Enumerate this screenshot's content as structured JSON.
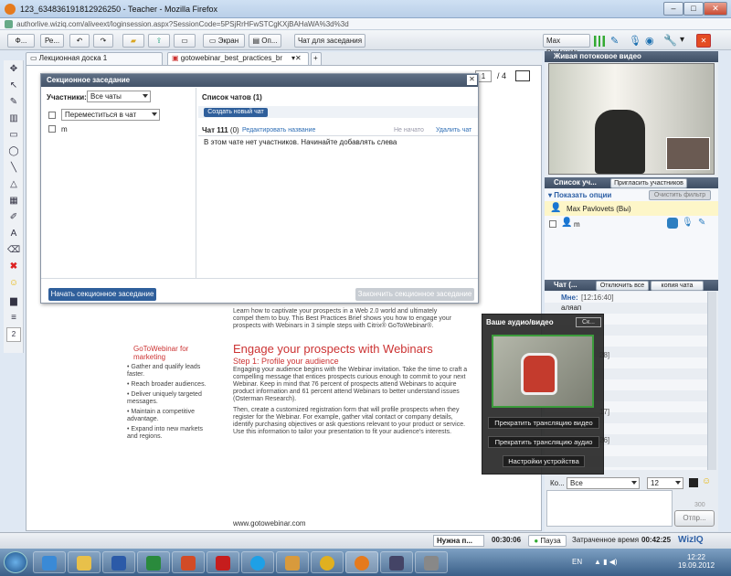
{
  "window": {
    "title": "123_634836191812926250 - Teacher - Mozilla Firefox",
    "url": "authorlive.wiziq.com/aliveext/loginsession.aspx?SessionCode=5PSjRrHFwSTCgKXjBAHaWA%3d%3d"
  },
  "toolbar": {
    "file": "Ф...",
    "re": "Ре...",
    "screen": "Экран",
    "op": "Оп...",
    "chat_meeting": "Чат для заседания",
    "user": "Max Pavlovets"
  },
  "tabs": {
    "board": "Лекционная доска 1",
    "doc": "gotowebinar_best_practices_br",
    "add": "+"
  },
  "pager": {
    "current": "1",
    "total": "/ 4"
  },
  "breakout": {
    "title": "Секционное заседание",
    "participants_label": "Участники:",
    "participants_filter": "Все чаты",
    "move_to_chat": "Переместиться в чат",
    "participant": "m",
    "chat_list_title": "Список чатов (1)",
    "create_chat": "Создать новый чат",
    "chat_name": "Чат 111",
    "chat_count": "(0)",
    "edit_name": "Редактировать название",
    "not_started": "Не начато",
    "delete_chat": "Удалить чат",
    "empty_msg": "В этом чате нет участников. Начинайте добавлять слева",
    "start_btn": "Начать секционное заседание",
    "end_btn": "Закончить секционное заседание"
  },
  "pdf": {
    "intro1": "Learn how to captivate your prospects in a Web 2.0 world and ultimately",
    "intro2": "compel them to buy. This Best Practices Brief shows you how to engage your",
    "intro3": "prospects with Webinars in 3 simple steps with Citrix® GoToWebinar®.",
    "side_title": "GoToWebinar for marketing",
    "bullets": [
      "Gather and qualify leads faster.",
      "Reach broader audiences.",
      "Deliver uniquely targeted messages.",
      "Maintain a competitive advantage.",
      "Expand into new markets and regions."
    ],
    "heading": "Engage your prospects with Webinars",
    "step": "Step 1: Profile your audience",
    "p1": "Engaging your audience begins with the Webinar invitation. Take the time to craft a compelling message that entices prospects curious enough to commit to your next Webinar. Keep in mind that 76 percent of prospects attend Webinars to acquire product information and 61 percent attend Webinars to better understand issues (Osterman Research).",
    "p2": "Then, create a customized registration form that will profile prospects when they register for the Webinar. For example, gather vital contact or company details, identify purchasing objectives or ask questions relevant to your product or service. Use this information to tailor your presentation to fit your audience's interests.",
    "footer": "www.gotowebinar.com"
  },
  "video": {
    "title": "Живая потоковое видео"
  },
  "participants": {
    "title": "Список уч...",
    "invite": "Пригласить участников",
    "show_options": "Показать опции",
    "clear_filter": "Очистить фильтр",
    "me": "Max Pavlovets (Вы)",
    "other": "m"
  },
  "chat": {
    "title": "Чат (...",
    "disable_all": "Отключить все",
    "copy_chat": "копия чата",
    "sender": "Мне:",
    "time": "[12:16:40]",
    "msg": "аляап",
    "t2": "28]",
    "t3": "17]",
    "t4": "26]",
    "to_label": "Ко...",
    "to_value": "Все",
    "size": "12",
    "counter": "300",
    "send": "Отпр..."
  },
  "av": {
    "title": "Ваше аудио/видео",
    "close": "Ск...",
    "stop_video": "Прекратить трансляцию видео",
    "stop_audio": "Прекратить трансляцию аудио",
    "settings": "Настройки устройства"
  },
  "status": {
    "need_help": "Нужна п...",
    "elapsed": "00:30:06",
    "pause": "Пауза",
    "spent_label": "Затраченное время",
    "spent": "00:42:25",
    "brand": "WizIQ"
  },
  "tray": {
    "lang": "EN",
    "time": "12:22",
    "date": "19.09.2012"
  }
}
